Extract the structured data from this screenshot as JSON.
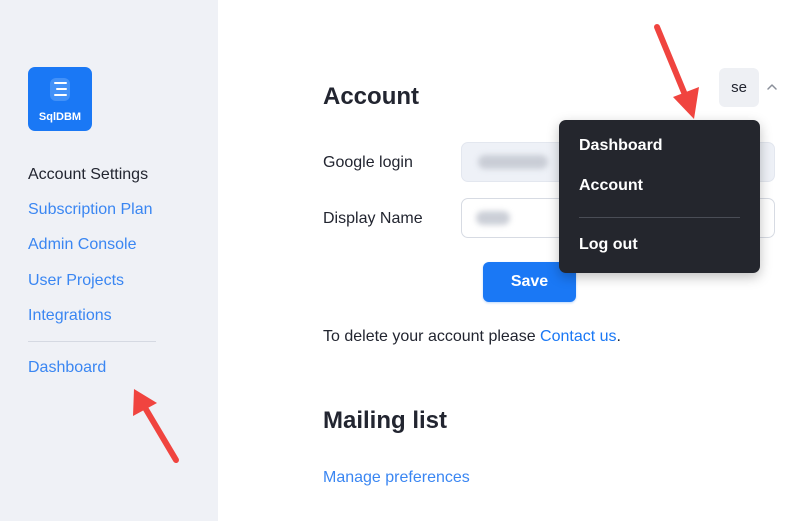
{
  "brand": {
    "logo_text": "SqlDBM"
  },
  "sidebar": {
    "items": [
      {
        "label": "Account Settings",
        "active": true
      },
      {
        "label": "Subscription Plan"
      },
      {
        "label": "Admin Console"
      },
      {
        "label": "User Projects"
      },
      {
        "label": "Integrations"
      }
    ],
    "bottom_item": {
      "label": "Dashboard"
    }
  },
  "account": {
    "title": "Account",
    "google_login_label": "Google login",
    "display_name_label": "Display Name",
    "save_label": "Save",
    "delete_prefix": "To delete your account please ",
    "delete_link": "Contact us",
    "delete_suffix": "."
  },
  "mailing": {
    "title": "Mailing list",
    "manage_link": "Manage preferences"
  },
  "user_menu": {
    "avatar_text": "se",
    "chevron_icon": "chevron-up-icon",
    "items": [
      {
        "label": "Dashboard"
      },
      {
        "label": "Account"
      },
      {
        "label": "Log out"
      }
    ]
  },
  "colors": {
    "accent": "#1a78f5",
    "link": "#3a86f2",
    "sidebar_bg": "#eff1f6",
    "dropdown_bg": "#24262d",
    "annotation_arrow": "#f0443f"
  }
}
